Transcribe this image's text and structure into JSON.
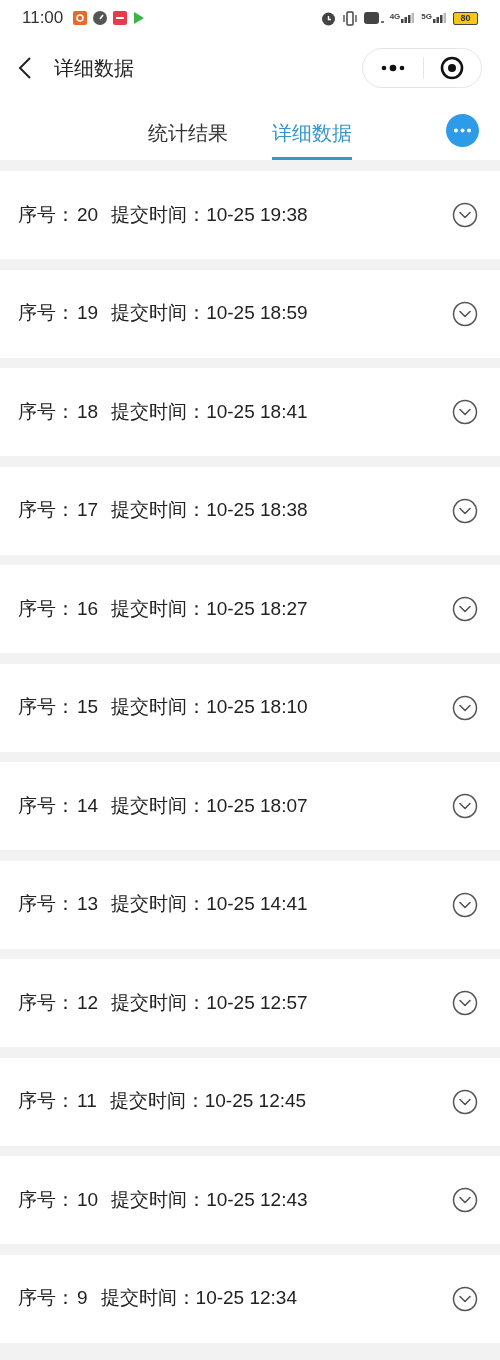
{
  "status_bar": {
    "time": "11:00",
    "network": [
      "4G",
      "5G"
    ],
    "battery": "80"
  },
  "nav": {
    "title": "详细数据"
  },
  "tabs": [
    {
      "label": "统计结果",
      "selected": false
    },
    {
      "label": "详细数据",
      "selected": true
    }
  ],
  "rows": [
    {
      "seq_label": "序号：",
      "seq": "20",
      "time_label": "提交时间：",
      "time": "10-25 19:38",
      "expanded": false
    },
    {
      "seq_label": "序号：",
      "seq": "19",
      "time_label": "提交时间：",
      "time": "10-25 18:59",
      "expanded": false
    },
    {
      "seq_label": "序号：",
      "seq": "18",
      "time_label": "提交时间：",
      "time": "10-25 18:41",
      "expanded": false
    },
    {
      "seq_label": "序号：",
      "seq": "17",
      "time_label": "提交时间：",
      "time": "10-25 18:38",
      "expanded": false
    },
    {
      "seq_label": "序号：",
      "seq": "16",
      "time_label": "提交时间：",
      "time": "10-25 18:27",
      "expanded": false
    },
    {
      "seq_label": "序号：",
      "seq": "15",
      "time_label": "提交时间：",
      "time": "10-25 18:10",
      "expanded": false
    },
    {
      "seq_label": "序号：",
      "seq": "14",
      "time_label": "提交时间：",
      "time": "10-25 18:07",
      "expanded": false
    },
    {
      "seq_label": "序号：",
      "seq": "13",
      "time_label": "提交时间：",
      "time": "10-25 14:41",
      "expanded": false
    },
    {
      "seq_label": "序号：",
      "seq": "12",
      "time_label": "提交时间：",
      "time": "10-25 12:57",
      "expanded": false
    },
    {
      "seq_label": "序号：",
      "seq": "11",
      "time_label": "提交时间：",
      "time": "10-25 12:45",
      "expanded": false
    },
    {
      "seq_label": "序号：",
      "seq": "10",
      "time_label": "提交时间：",
      "time": "10-25 12:43",
      "expanded": false
    },
    {
      "seq_label": "序号：",
      "seq": "9",
      "time_label": "提交时间：",
      "time": "10-25 12:34",
      "expanded": false
    }
  ]
}
